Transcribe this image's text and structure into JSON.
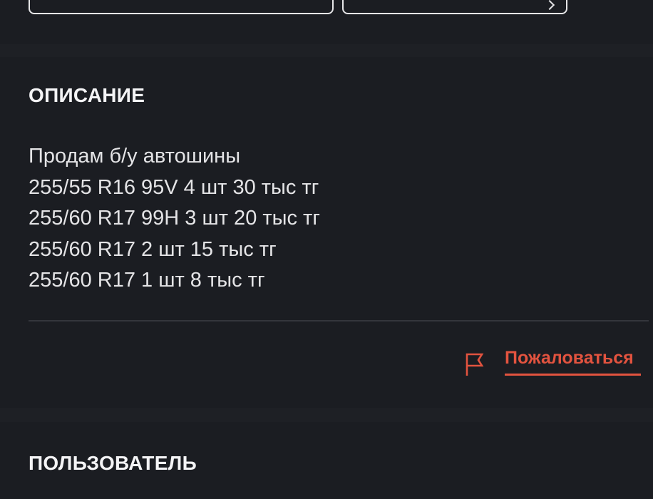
{
  "colors": {
    "background": "#1e2025",
    "panel": "#1b1d22",
    "text": "#e4e4e6",
    "accent": "#e2533f",
    "divider": "#34363c"
  },
  "description_section": {
    "title": "ОПИСАНИЕ",
    "lines": [
      "Продам б/у автошины",
      "255/55 R16 95V 4 шт 30 тыс тг",
      "255/60 R17 99H 3 шт 20 тыс тг",
      "255/60 R17 2 шт 15 тыс тг",
      "255/60 R17 1 шт 8 тыс тг"
    ]
  },
  "report": {
    "icon": "flag-icon",
    "label": "Пожаловаться"
  },
  "user_section": {
    "title": "ПОЛЬЗОВАТЕЛЬ"
  }
}
